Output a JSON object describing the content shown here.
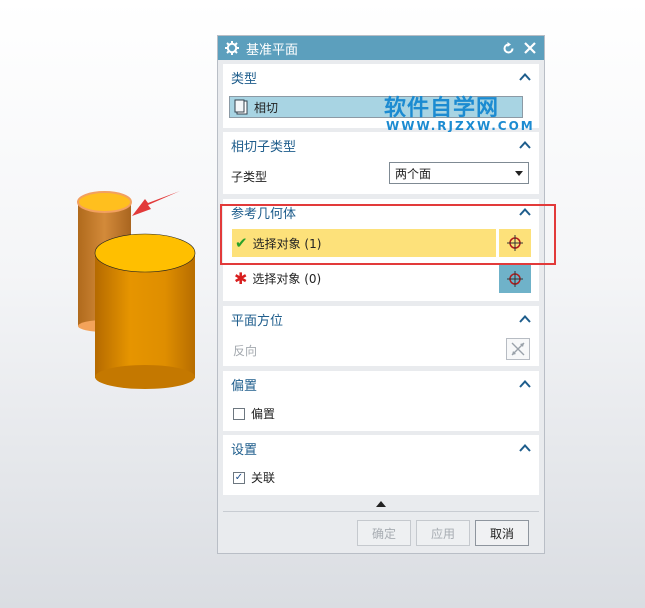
{
  "dialog": {
    "title": "基准平面",
    "icons": {
      "title_icon": "gear-icon",
      "reset": "reset-icon",
      "close": "close-icon"
    }
  },
  "sections": {
    "type": {
      "header": "类型",
      "value": "相切"
    },
    "subtype": {
      "header": "相切子类型",
      "field_label": "子类型",
      "selected": "两个面"
    },
    "reference": {
      "header": "参考几何体",
      "row1": "选择对象 (1)",
      "row2": "选择对象 (0)"
    },
    "orientation": {
      "header": "平面方位",
      "reverse": "反向"
    },
    "offset": {
      "header": "偏置",
      "checkbox_label": "偏置",
      "checked": false
    },
    "settings": {
      "header": "设置",
      "checkbox_label": "关联",
      "checked": true
    }
  },
  "footer": {
    "ok": "确定",
    "apply": "应用",
    "cancel": "取消"
  },
  "watermark": {
    "main": "软件自学网",
    "sub": "WWW.RJZXW.COM"
  },
  "colors": {
    "titlebar": "#5c9fbd",
    "section_header": "#1e5d8c",
    "active_row": "#fde17a",
    "highlight": "#e23a3a",
    "cylinder": "#e49200"
  }
}
